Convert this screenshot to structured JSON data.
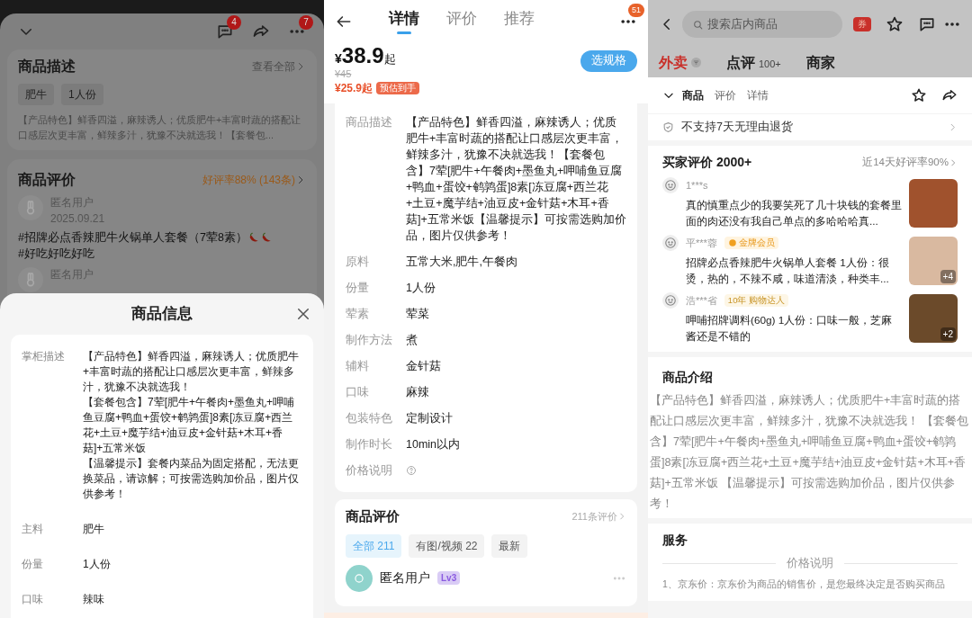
{
  "left_screen": {
    "header": {
      "chat_badge": "4",
      "more_badge": "7"
    },
    "description_card": {
      "title": "商品描述",
      "link": "查看全部",
      "tags": [
        "肥牛",
        "1人份"
      ],
      "text": "【产品特色】鲜香四溢，麻辣诱人；优质肥牛+丰富时蔬的搭配让口感层次更丰富，鲜辣多汁，犹豫不决就选我！【套餐包..."
    },
    "review_card": {
      "title": "商品评价",
      "rating": "好评率88% (143条)",
      "reviews": [
        {
          "user": "匿名用户",
          "date": "2025.09.21",
          "text_parts": [
            {
              "kind": "text",
              "text": "#招牌必点香辣肥牛火锅单人套餐（7荤8素）"
            },
            {
              "kind": "chili"
            },
            {
              "kind": "chili"
            },
            {
              "kind": "text",
              "text": "#好吃好吃好吃"
            }
          ]
        },
        {
          "user": "匿名用户"
        }
      ]
    },
    "sheet": {
      "title": "商品信息",
      "rows": [
        {
          "label": "掌柜描述",
          "paragraphs": [
            "【产品特色】鲜香四溢，麻辣诱人；优质肥牛+丰富时蔬的搭配让口感层次更丰富，鲜辣多汁，犹豫不决就选我！",
            "【套餐包含】7荤[肥牛+午餐肉+墨鱼丸+呷哺鱼豆腐+鸭血+蛋饺+鹌鹑蛋]8素[冻豆腐+西兰花+土豆+魔芋结+油豆皮+金针菇+木耳+香菇]+五常米饭",
            "【温馨提示】套餐内菜品为固定搭配，无法更换菜品，请谅解；可按需选购加价品，图片仅供参考！"
          ]
        },
        {
          "label": "主料",
          "paragraphs": [
            "肥牛"
          ]
        },
        {
          "label": "份量",
          "paragraphs": [
            "1人份"
          ]
        },
        {
          "label": "口味",
          "paragraphs": [
            "辣味"
          ]
        }
      ]
    }
  },
  "middle_screen": {
    "tabs": [
      {
        "label": "详情",
        "selected": true
      },
      {
        "label": "评价",
        "selected": false
      },
      {
        "label": "推荐",
        "selected": false
      }
    ],
    "more_badge": "51",
    "price": {
      "currency": "¥",
      "amount": "38.9",
      "suffix": "起",
      "original": "¥45",
      "estimate": "¥25.9起",
      "estimate_tag": "预估到手"
    },
    "spec_button": "选规格",
    "properties": [
      {
        "kind": "text",
        "label": "商品描述",
        "value": "【产品特色】鲜香四溢，麻辣诱人；优质肥牛+丰富时蔬的搭配让口感层次更丰富，鲜辣多汁，犹豫不决就选我！【套餐包含】7荤[肥牛+午餐肉+墨鱼丸+呷哺鱼豆腐+鸭血+蛋饺+鹌鹑蛋]8素[冻豆腐+西兰花+土豆+魔芋结+油豆皮+金针菇+木耳+香菇]+五常米饭【温馨提示】可按需选购加价品，图片仅供参考！"
      },
      {
        "kind": "text",
        "label": "原料",
        "value": "五常大米,肥牛,午餐肉"
      },
      {
        "kind": "text",
        "label": "份量",
        "value": "1人份"
      },
      {
        "kind": "text",
        "label": "荤素",
        "value": "荤菜"
      },
      {
        "kind": "text",
        "label": "制作方法",
        "value": "煮"
      },
      {
        "kind": "text",
        "label": "辅料",
        "value": "金针菇"
      },
      {
        "kind": "text",
        "label": "口味",
        "value": "麻辣"
      },
      {
        "kind": "text",
        "label": "包装特色",
        "value": "定制设计"
      },
      {
        "kind": "text",
        "label": "制作时长",
        "value": "10min以内"
      },
      {
        "kind": "help",
        "label": "价格说明"
      }
    ],
    "reviews": {
      "title": "商品评价",
      "count": "211条评价",
      "filters": [
        {
          "label": "全部 211",
          "selected": true
        },
        {
          "label": "有图/视频 22",
          "selected": false
        },
        {
          "label": "最新",
          "selected": false
        }
      ],
      "user": "匿名用户",
      "level": "Lv3"
    }
  },
  "right_screen": {
    "search": {
      "placeholder": "搜索店内商品"
    },
    "coupon": "券",
    "tabs": [
      {
        "label": "外卖",
        "selected": true
      },
      {
        "label": "点评",
        "extra": "100+",
        "selected": false
      },
      {
        "label": "商家",
        "selected": false
      }
    ],
    "subtabs": [
      {
        "label": "商品",
        "selected": true
      },
      {
        "label": "评价",
        "selected": false
      },
      {
        "label": "详情",
        "selected": false
      }
    ],
    "return_policy": "不支持7天无理由退货",
    "buyer_reviews": {
      "title": "买家评价 2000+",
      "rating": "近14天好评率90%",
      "items": [
        {
          "user": "1***s",
          "text": "真的慎重点少的我要笑死了几十块钱的套餐里面的肉还没有我自己单点的多哈哈哈真..."
        },
        {
          "user": "平***蓉",
          "badge": {
            "kind": "gold",
            "label": "金牌会员"
          },
          "text": "招牌必点香辣肥牛火锅单人套餐 1人份：很烫，热的，不辣不咸，味道清淡，种类丰...",
          "photo_count": "+4"
        },
        {
          "user": "浩***省",
          "badge": {
            "kind": "veteran",
            "label": "10年 购物达人"
          },
          "text": "呷哺招牌调料(60g) 1人份：口味一般，芝麻酱还是不错的",
          "photo_count": "+2"
        }
      ]
    },
    "intro": {
      "title": "商品介绍",
      "text": "【产品特色】鲜香四溢，麻辣诱人；优质肥牛+丰富时蔬的搭配让口感层次更丰富，鲜辣多汁，犹豫不决就选我！ 【套餐包含】7荤[肥牛+午餐肉+墨鱼丸+呷哺鱼豆腐+鸭血+蛋饺+鹌鹑蛋]8素[冻豆腐+西兰花+土豆+魔芋结+油豆皮+金针菇+木耳+香菇]+五常米饭 【温馨提示】可按需选购加价品，图片仅供参考！"
    },
    "service": {
      "title": "服务",
      "divider_label": "价格说明",
      "text": "1、京东价：京东价为商品的销售价，是您最终决定是否购买商品"
    }
  }
}
